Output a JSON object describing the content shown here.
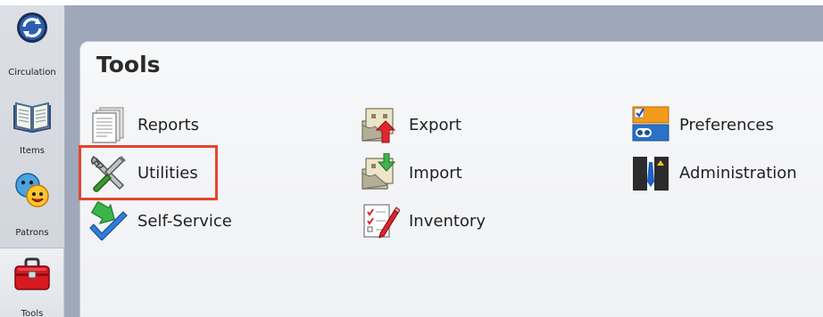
{
  "sidebar": {
    "items": [
      {
        "label": "Circulation",
        "icon": "circulation-icon",
        "active": false
      },
      {
        "label": "Items",
        "icon": "book-icon",
        "active": false
      },
      {
        "label": "Patrons",
        "icon": "patrons-icon",
        "active": false
      },
      {
        "label": "Tools",
        "icon": "toolbox-icon",
        "active": true
      }
    ]
  },
  "main": {
    "title": "Tools",
    "tools": [
      {
        "label": "Reports",
        "icon": "reports-icon"
      },
      {
        "label": "Utilities",
        "icon": "utilities-icon",
        "highlighted": true
      },
      {
        "label": "Self-Service",
        "icon": "self-service-icon"
      },
      {
        "label": "Export",
        "icon": "export-icon"
      },
      {
        "label": "Import",
        "icon": "import-icon"
      },
      {
        "label": "Inventory",
        "icon": "inventory-icon"
      },
      {
        "label": "Preferences",
        "icon": "preferences-icon"
      },
      {
        "label": "Administration",
        "icon": "administration-icon"
      }
    ]
  },
  "colors": {
    "highlight": "#e2452f",
    "content_background": "#9fa7ba",
    "panel_background": "#f4f5f8"
  }
}
